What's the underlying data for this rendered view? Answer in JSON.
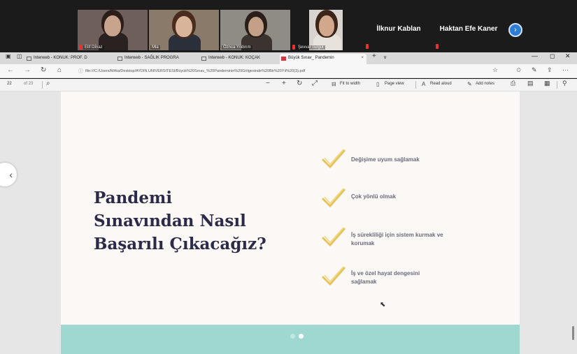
{
  "meeting": {
    "participants": [
      {
        "name": "Elif Dİnaz"
      },
      {
        "name": "Mla"
      },
      {
        "name": "Öznca Yıldırım"
      },
      {
        "name": "Şevval Turgut"
      },
      {
        "name": "İlknur Kablan"
      },
      {
        "name": "Haktan Efe Kaner"
      }
    ],
    "next_icon": "chevron-right-icon"
  },
  "browser": {
    "tabs": [
      {
        "label": "Interweb - KONUK: PROF. D"
      },
      {
        "label": "Interweb - SAĞLIK PROGRA"
      },
      {
        "label": "Interweb - KONUK: KOÇAK"
      },
      {
        "label": "Büyük Sınav_ Pandemin"
      }
    ],
    "new_tab": "+",
    "tab_menu": "∨",
    "url": "file:///C:/Users/MAta/Desktop/AYDIN.UNIVERSITESI/Büyük%20Sınav_%20Pandeminin%20Gölgesinde%20Bir%20Yıl%20(3).pdf"
  },
  "pdf_toolbar": {
    "page_current": "22",
    "page_total": "of 23",
    "fit_to_width": "Fit to width",
    "page_view": "Page view",
    "read_aloud": "Read aloud",
    "add_notes": "Add notes"
  },
  "slide": {
    "title_lines": [
      "Pandemi",
      "Sınavından Nasıl",
      "Başarılı Çıkacağız?"
    ],
    "bullets": [
      [
        "Değişime uyum sağlamak"
      ],
      [
        "Çok yönlü olmak"
      ],
      [
        "İş sürekliliği için sistem kurmak ve",
        "korumak"
      ],
      [
        "İş ve özel hayat dengesini",
        "sağlamak"
      ]
    ],
    "colors": {
      "title": "#2b2b48",
      "check": "#e6c65a",
      "band": "#9fd8d1",
      "page": "#fcf8f6"
    }
  }
}
